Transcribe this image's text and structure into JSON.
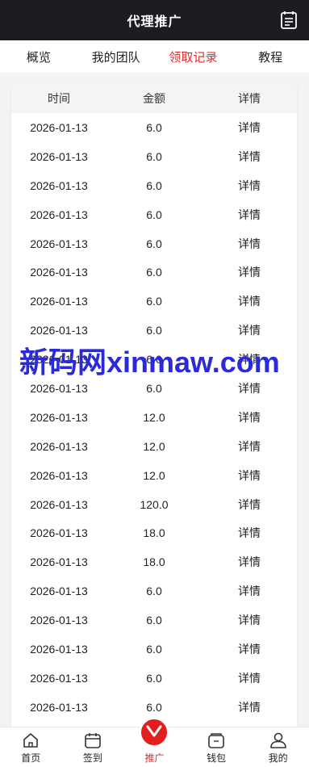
{
  "header": {
    "title": "代理推广",
    "right_icon": "document-icon"
  },
  "tabs": [
    {
      "label": "概览",
      "active": false
    },
    {
      "label": "我的团队",
      "active": false
    },
    {
      "label": "领取记录",
      "active": true
    },
    {
      "label": "教程",
      "active": false
    }
  ],
  "colors": {
    "accent": "#e02b2b",
    "header_bg": "#1c1c22",
    "watermark": "#2a2ad8"
  },
  "table": {
    "headers": [
      "时间",
      "金额",
      "详情"
    ],
    "rows": [
      {
        "time": "2026-01-13",
        "amount": "6.0",
        "detail": "详情"
      },
      {
        "time": "2026-01-13",
        "amount": "6.0",
        "detail": "详情"
      },
      {
        "time": "2026-01-13",
        "amount": "6.0",
        "detail": "详情"
      },
      {
        "time": "2026-01-13",
        "amount": "6.0",
        "detail": "详情"
      },
      {
        "time": "2026-01-13",
        "amount": "6.0",
        "detail": "详情"
      },
      {
        "time": "2026-01-13",
        "amount": "6.0",
        "detail": "详情"
      },
      {
        "time": "2026-01-13",
        "amount": "6.0",
        "detail": "详情"
      },
      {
        "time": "2026-01-13",
        "amount": "6.0",
        "detail": "详情"
      },
      {
        "time": "2026-01-13",
        "amount": "6.0",
        "detail": "详情"
      },
      {
        "time": "2026-01-13",
        "amount": "6.0",
        "detail": "详情"
      },
      {
        "time": "2026-01-13",
        "amount": "12.0",
        "detail": "详情"
      },
      {
        "time": "2026-01-13",
        "amount": "12.0",
        "detail": "详情"
      },
      {
        "time": "2026-01-13",
        "amount": "12.0",
        "detail": "详情"
      },
      {
        "time": "2026-01-13",
        "amount": "120.0",
        "detail": "详情"
      },
      {
        "time": "2026-01-13",
        "amount": "18.0",
        "detail": "详情"
      },
      {
        "time": "2026-01-13",
        "amount": "18.0",
        "detail": "详情"
      },
      {
        "time": "2026-01-13",
        "amount": "6.0",
        "detail": "详情"
      },
      {
        "time": "2026-01-13",
        "amount": "6.0",
        "detail": "详情"
      },
      {
        "time": "2026-01-13",
        "amount": "6.0",
        "detail": "详情"
      },
      {
        "time": "2026-01-13",
        "amount": "6.0",
        "detail": "详情"
      },
      {
        "time": "2026-01-13",
        "amount": "6.0",
        "detail": "详情"
      }
    ]
  },
  "watermark": "新码网xinmaw.com",
  "bottom_nav": [
    {
      "label": "首页",
      "icon": "home-icon",
      "active": false
    },
    {
      "label": "签到",
      "icon": "calendar-icon",
      "active": false
    },
    {
      "label": "推广",
      "icon": "promo-icon",
      "active": true
    },
    {
      "label": "钱包",
      "icon": "wallet-icon",
      "active": false
    },
    {
      "label": "我的",
      "icon": "user-icon",
      "active": false
    }
  ]
}
